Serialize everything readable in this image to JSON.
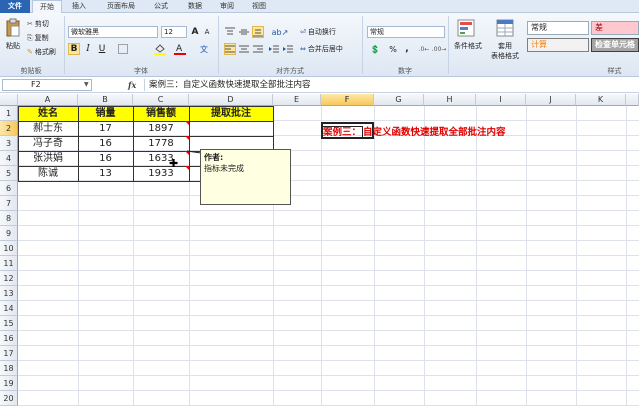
{
  "tabs": [
    "文件",
    "开始",
    "插入",
    "页面布局",
    "公式",
    "数据",
    "审阅",
    "视图"
  ],
  "clipboard": {
    "paste": "粘贴",
    "cut": "剪切",
    "copy": "复制",
    "format_painter": "格式刷",
    "group": "剪贴板"
  },
  "font": {
    "name": "微软雅黑",
    "size": "12",
    "bold": "B",
    "italic": "I",
    "underline": "U",
    "grow": "A",
    "shrink": "A",
    "group": "字体"
  },
  "alignment": {
    "wrap": "自动换行",
    "merge": "合并后居中",
    "group": "对齐方式"
  },
  "number": {
    "format": "常规",
    "percent": "%",
    "comma": ",",
    "group": "数字"
  },
  "styles": {
    "cond_format": "条件格式",
    "table_format": "套用\n表格格式",
    "normal": "常规",
    "bad": "差",
    "calc": "计算",
    "check": "检查单元格",
    "group": "样式"
  },
  "formula_bar": {
    "name_box": "F2",
    "fx": "fx",
    "content": "案例三：自定义函数快速提取全部批注内容"
  },
  "columns": [
    "A",
    "B",
    "C",
    "D",
    "E",
    "F",
    "G",
    "H",
    "I",
    "J",
    "K"
  ],
  "rows": [
    "1",
    "2",
    "3",
    "4",
    "5",
    "6",
    "7",
    "8",
    "9",
    "10",
    "11",
    "12",
    "13",
    "14",
    "15",
    "16",
    "17",
    "18",
    "19",
    "20"
  ],
  "table": {
    "headers": [
      "姓名",
      "销量",
      "销售额",
      "提取批注"
    ],
    "data": [
      [
        "郝士东",
        "17",
        "1897",
        ""
      ],
      [
        "冯子奇",
        "16",
        "1778",
        ""
      ],
      [
        "张洪娟",
        "16",
        "1633",
        ""
      ],
      [
        "陈诚",
        "13",
        "1933",
        ""
      ]
    ]
  },
  "comment": {
    "author": "作者:",
    "text": "指标未完成"
  },
  "note": {
    "boxed": "案例三：",
    "rest": "自定义函数快速提取全部批注内容"
  },
  "colors": {
    "header_fill": "#ffff00",
    "note_red": "#e00000",
    "file_tab": "#2a64b3"
  }
}
